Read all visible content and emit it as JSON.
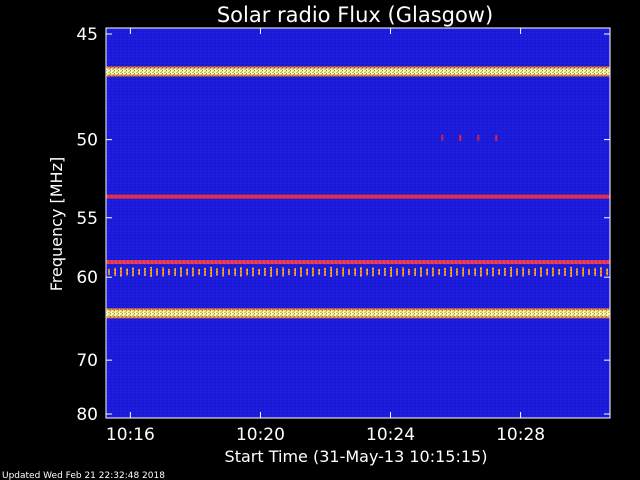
{
  "chart_data": {
    "type": "heatmap",
    "title": "Solar radio Flux (Glasgow)",
    "ylabel": "Frequency [MHz]",
    "xlabel": "Start Time (31-May-13 10:15:15)",
    "ylim": [
      45,
      80
    ],
    "y_ticks": [
      45,
      50,
      55,
      60,
      70,
      80
    ],
    "y_tick_labels": [
      "45",
      "50",
      "55",
      "60",
      "70",
      "80"
    ],
    "y_scale": "nonlinear",
    "xlim": [
      "10:15:15",
      "10:30:45"
    ],
    "x_ticks": [
      "10:16",
      "10:20",
      "10:24",
      "10:28"
    ],
    "background_color": "#1a1ad8",
    "grid": false,
    "emission_bands": [
      {
        "frequency_mhz": 46.6,
        "intensity": "very high",
        "color": "#ffff90"
      },
      {
        "frequency_mhz": 53.5,
        "intensity": "high",
        "color": "#ff3030"
      },
      {
        "frequency_mhz": 58.6,
        "intensity": "high",
        "color": "#ff4040"
      },
      {
        "frequency_mhz": 63.8,
        "intensity": "very high",
        "color": "#ffff80"
      }
    ],
    "bursts": [
      {
        "frequency_mhz": 59.5,
        "type": "intermittent spikes",
        "color": "#ffa020",
        "time_range": [
          "10:15:15",
          "10:30:45"
        ]
      },
      {
        "frequency_mhz": 49.9,
        "type": "short bursts",
        "color": "#ff2020",
        "time_range": [
          "10:25:30",
          "10:27:30"
        ]
      }
    ]
  },
  "footer": {
    "updated_text": "Updated Wed Feb 21 22:32:48 2018"
  }
}
